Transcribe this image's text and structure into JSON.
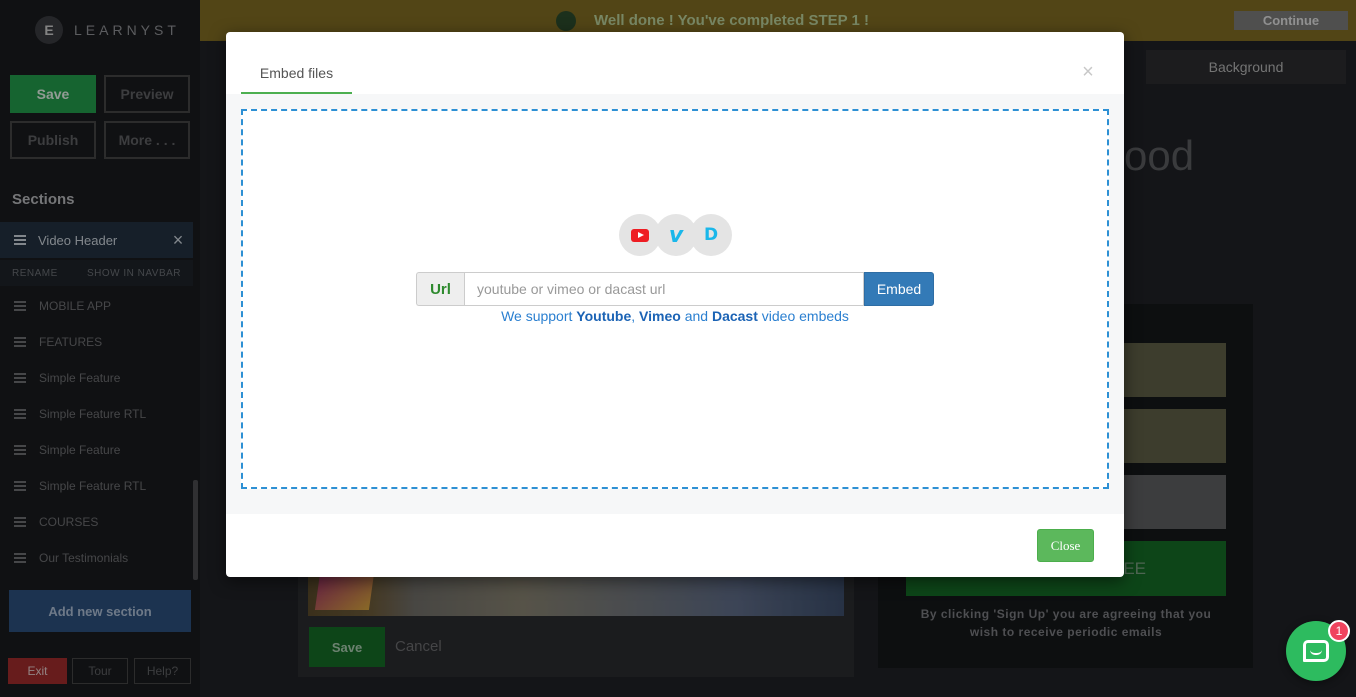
{
  "sidebar": {
    "logo_mark": "E",
    "logo_text": "LEARNYST",
    "buttons": {
      "save": "Save",
      "preview": "Preview",
      "publish": "Publish",
      "more": "More . . ."
    },
    "sections_title": "Sections",
    "active_section": {
      "label": "Video Header",
      "rename": "RENAME",
      "show_in_navbar": "SHOW IN NAVBAR"
    },
    "items": [
      {
        "label": "MOBILE APP"
      },
      {
        "label": "FEATURES"
      },
      {
        "label": "Simple Feature"
      },
      {
        "label": "Simple Feature RTL"
      },
      {
        "label": "Simple Feature"
      },
      {
        "label": "Simple Feature RTL"
      },
      {
        "label": "COURSES"
      },
      {
        "label": "Our Testimonials"
      }
    ],
    "add_section": "Add new section",
    "footer": {
      "exit": "Exit",
      "tour": "Tour",
      "help": "Help?"
    }
  },
  "banner": {
    "text": "Well done ! You've completed STEP 1 !",
    "continue": "Continue"
  },
  "background": {
    "bg_button": "Background",
    "headline_fragment": "ood",
    "signup_fragment": "EE",
    "disclaimer": "By clicking 'Sign Up' you are agreeing that you wish to receive periodic emails",
    "editor": {
      "save": "Save",
      "cancel": "Cancel"
    }
  },
  "modal": {
    "tab": "Embed files",
    "close_x": "×",
    "url_label": "Url",
    "url_placeholder": "youtube or vimeo or dacast url",
    "embed_button": "Embed",
    "support": {
      "prefix": "We support",
      "youtube": "Youtube",
      "comma": ",",
      "vimeo": "Vimeo",
      "and": "and",
      "dacast": "Dacast",
      "suffix": "video embeds"
    },
    "service_icons": {
      "youtube": "youtube-icon",
      "vimeo": "v",
      "dacast": "D"
    },
    "close_button": "Close"
  },
  "chat": {
    "badge": "1"
  },
  "colors": {
    "accent_green": "#5cb85c",
    "primary_blue": "#337ab7",
    "dropzone_border": "#2d90d4",
    "banner": "#7e6a23"
  }
}
